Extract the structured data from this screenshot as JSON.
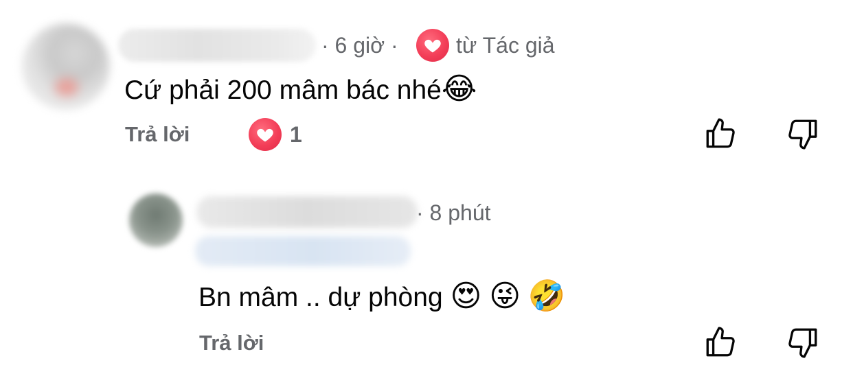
{
  "comment": {
    "time": "· 6 giờ ·",
    "author_reaction_label": "từ Tác giả",
    "text": "Cứ phải 200 mâm bác nhé",
    "emoji": "😂",
    "reply_label": "Trả lời",
    "reaction_count": "1"
  },
  "reply": {
    "time": "· 8 phút",
    "text": "Bn mâm .. dự phòng",
    "emojis": [
      "😍",
      "😜",
      "🤣"
    ],
    "reply_label": "Trả lời"
  },
  "colors": {
    "reaction_heart": "#f33e58",
    "meta_text": "#65676b",
    "body_text": "#050505"
  }
}
